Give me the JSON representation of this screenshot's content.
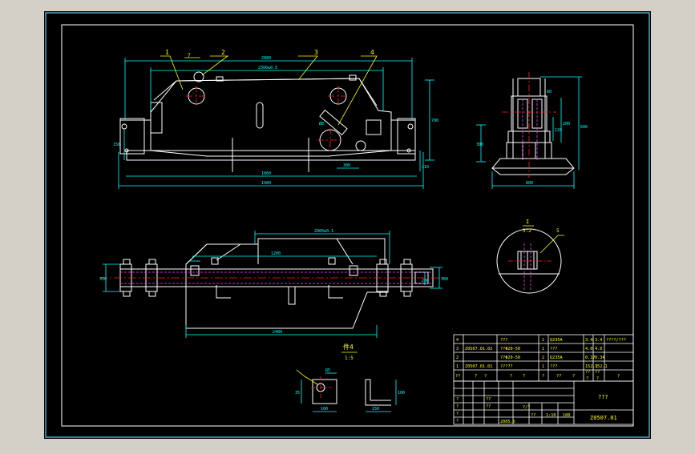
{
  "colors": {
    "canvas": "#000000",
    "frame": "#ffffff",
    "outer_border": "#4aa7c9",
    "part": "#ffffff",
    "dim": "#00ffff",
    "centerline": "#ff2020",
    "leader": "#ffff00",
    "hidden": "#ff40ff",
    "table_text": "#ffff00",
    "table_lines": "#ffffff",
    "page_bg": "#d4d0c8"
  },
  "front_view": {
    "balloons": [
      "1",
      "2",
      "3",
      "4"
    ],
    "balloon_extra": "7",
    "dims": {
      "top_overall": "2880",
      "top_inner": "2300±0.5",
      "bottom_a": "1860",
      "bottom_b": "1980",
      "right_height": "780",
      "right_small": "110",
      "bottom_small": "300",
      "left_height": "150",
      "slot": "Ø8"
    }
  },
  "side_view": {
    "dims": {
      "width": "800",
      "height_a": "600",
      "height_b": "200",
      "left": "300",
      "small_a": "120",
      "small_b": "60"
    }
  },
  "plan_view": {
    "dims": {
      "top": "2900±0.1",
      "mid": "1200",
      "overall": "2480",
      "left_h": "350",
      "right_h": "380",
      "right_small": "200"
    }
  },
  "detail_i": {
    "label": "I",
    "scale": "3:2",
    "leader": "5"
  },
  "detail_4": {
    "title": "件4",
    "scale": "1:5",
    "dims": [
      "35",
      "100",
      "R5",
      "150",
      "100"
    ]
  },
  "bom": [
    {
      "no": "4",
      "code": "",
      "name": "???",
      "qty": "1",
      "material": "Q235A",
      "unit": "3.4",
      "total": "3.4",
      "note": "????/???"
    },
    {
      "no": "3",
      "code": "Z0507.01.02",
      "name": "??Φ20-50",
      "qty": "1",
      "material": "???",
      "unit": "4.0",
      "total": "4.0",
      "note": ""
    },
    {
      "no": "2",
      "code": "",
      "name": "??Φ20-50",
      "qty": "2",
      "material": "Q235A",
      "unit": "0.17",
      "total": "0.34",
      "note": ""
    },
    {
      "no": "1",
      "code": "Z0507.01.01",
      "name": "?????",
      "qty": "1",
      "material": "???",
      "unit": "152.1",
      "total": "152.1",
      "note": ""
    }
  ],
  "bom_header": [
    "??",
    "?",
    "?",
    "?",
    "?",
    "?",
    "??",
    "?",
    "?",
    "?",
    "?"
  ],
  "bom_header_weight": [
    "??",
    "??"
  ],
  "title_block": {
    "name": "???",
    "drawing_no": "Z0507.01",
    "scale_label": "?/?",
    "count_a": "1:10",
    "count_b": "100",
    "weight": "??",
    "date_label": "2005.5",
    "small_labels": [
      "?",
      "?",
      "?",
      "?",
      "??",
      "??"
    ]
  }
}
